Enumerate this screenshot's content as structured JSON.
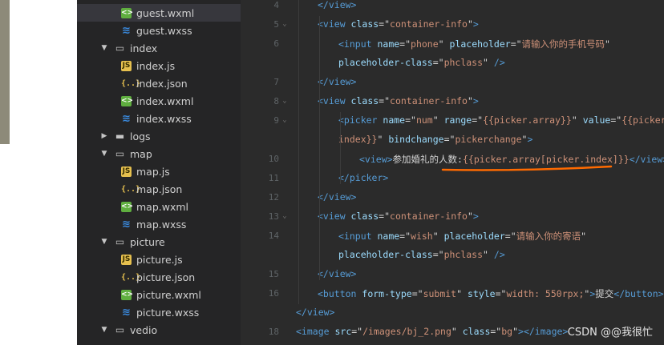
{
  "explorer": {
    "items": [
      {
        "label": "guest.wxml",
        "icon": "wxml-file-icon",
        "type": "file",
        "selected": true
      },
      {
        "label": "guest.wxss",
        "icon": "wxss-file-icon",
        "type": "file"
      },
      {
        "label": "index",
        "icon": "folder-open-icon",
        "type": "folder",
        "expanded": true
      },
      {
        "label": "index.js",
        "icon": "js-file-icon",
        "type": "file"
      },
      {
        "label": "index.json",
        "icon": "json-file-icon",
        "type": "file"
      },
      {
        "label": "index.wxml",
        "icon": "wxml-file-icon",
        "type": "file"
      },
      {
        "label": "index.wxss",
        "icon": "wxss-file-icon",
        "type": "file"
      },
      {
        "label": "logs",
        "icon": "folder-closed-icon",
        "type": "folder",
        "expanded": false
      },
      {
        "label": "map",
        "icon": "folder-open-icon",
        "type": "folder",
        "expanded": true
      },
      {
        "label": "map.js",
        "icon": "js-file-icon",
        "type": "file"
      },
      {
        "label": "map.json",
        "icon": "json-file-icon",
        "type": "file"
      },
      {
        "label": "map.wxml",
        "icon": "wxml-file-icon",
        "type": "file"
      },
      {
        "label": "map.wxss",
        "icon": "wxss-file-icon",
        "type": "file"
      },
      {
        "label": "picture",
        "icon": "folder-open-icon",
        "type": "folder",
        "expanded": true
      },
      {
        "label": "picture.js",
        "icon": "js-file-icon",
        "type": "file"
      },
      {
        "label": "picture.json",
        "icon": "json-file-icon",
        "type": "file"
      },
      {
        "label": "picture.wxml",
        "icon": "wxml-file-icon",
        "type": "file"
      },
      {
        "label": "picture.wxss",
        "icon": "wxss-file-icon",
        "type": "file"
      },
      {
        "label": "vedio",
        "icon": "folder-open-icon",
        "type": "folder",
        "expanded": true
      }
    ]
  },
  "editor": {
    "line_numbers": [
      "4",
      "5",
      "6",
      "",
      "7",
      "8",
      "9",
      "",
      "10",
      "11",
      "12",
      "13",
      "14",
      "",
      "15",
      "16",
      "",
      "18"
    ],
    "fold_markers": [
      "",
      "v",
      "",
      "",
      "",
      "v",
      "v",
      "",
      "",
      "",
      "",
      "v",
      "",
      "",
      "",
      "",
      "",
      ""
    ],
    "lines": [
      {
        "tokens": [
          [
            "t",
            "</view>"
          ]
        ]
      },
      {
        "tokens": [
          [
            "t",
            "<view "
          ],
          [
            "a",
            "class"
          ],
          [
            "p",
            "=\""
          ],
          [
            "s",
            "container-info"
          ],
          [
            "p",
            "\""
          ],
          [
            "t",
            ">"
          ]
        ]
      },
      {
        "tokens": [
          [
            "t",
            "<input "
          ],
          [
            "a",
            "name"
          ],
          [
            "p",
            "=\""
          ],
          [
            "s",
            "phone"
          ],
          [
            "p",
            "\" "
          ],
          [
            "a",
            "placeholder"
          ],
          [
            "p",
            "=\""
          ],
          [
            "s",
            "请输入你的手机号码"
          ],
          [
            "p",
            "\""
          ]
        ]
      },
      {
        "tokens": [
          [
            "a",
            "placeholder-class"
          ],
          [
            "p",
            "=\""
          ],
          [
            "s",
            "phclass"
          ],
          [
            "p",
            "\" "
          ],
          [
            "t",
            "/>"
          ]
        ]
      },
      {
        "tokens": [
          [
            "t",
            "</view>"
          ]
        ]
      },
      {
        "tokens": [
          [
            "t",
            "<view "
          ],
          [
            "a",
            "class"
          ],
          [
            "p",
            "=\""
          ],
          [
            "s",
            "container-info"
          ],
          [
            "p",
            "\""
          ],
          [
            "t",
            ">"
          ]
        ]
      },
      {
        "tokens": [
          [
            "t",
            "<picker "
          ],
          [
            "a",
            "name"
          ],
          [
            "p",
            "=\""
          ],
          [
            "s",
            "num"
          ],
          [
            "p",
            "\" "
          ],
          [
            "a",
            "range"
          ],
          [
            "p",
            "=\""
          ],
          [
            "s",
            "{{picker.array}}"
          ],
          [
            "p",
            "\" "
          ],
          [
            "a",
            "value"
          ],
          [
            "p",
            "=\""
          ],
          [
            "s",
            "{{picker."
          ]
        ]
      },
      {
        "tokens": [
          [
            "s",
            "index}}"
          ],
          [
            "p",
            "\" "
          ],
          [
            "a",
            "bindchange"
          ],
          [
            "p",
            "=\""
          ],
          [
            "s",
            "pickerchange"
          ],
          [
            "p",
            "\""
          ],
          [
            "t",
            ">"
          ]
        ]
      },
      {
        "tokens": [
          [
            "t",
            "<view>"
          ],
          [
            "p",
            "参加婚礼的人数:"
          ],
          [
            "s",
            "{{picker.array[picker.index]}}"
          ],
          [
            "t",
            "</view>"
          ]
        ]
      },
      {
        "tokens": [
          [
            "t",
            "</picker>"
          ]
        ]
      },
      {
        "tokens": [
          [
            "t",
            "</view>"
          ]
        ]
      },
      {
        "tokens": [
          [
            "t",
            "<view "
          ],
          [
            "a",
            "class"
          ],
          [
            "p",
            "=\""
          ],
          [
            "s",
            "container-info"
          ],
          [
            "p",
            "\""
          ],
          [
            "t",
            ">"
          ]
        ]
      },
      {
        "tokens": [
          [
            "t",
            "<input "
          ],
          [
            "a",
            "name"
          ],
          [
            "p",
            "=\""
          ],
          [
            "s",
            "wish"
          ],
          [
            "p",
            "\" "
          ],
          [
            "a",
            "placeholder"
          ],
          [
            "p",
            "=\""
          ],
          [
            "s",
            "请输入你的寄语"
          ],
          [
            "p",
            "\""
          ]
        ]
      },
      {
        "tokens": [
          [
            "a",
            "placeholder-class"
          ],
          [
            "p",
            "=\""
          ],
          [
            "s",
            "phclass"
          ],
          [
            "p",
            "\" "
          ],
          [
            "t",
            "/>"
          ]
        ]
      },
      {
        "tokens": [
          [
            "t",
            "</view>"
          ]
        ]
      },
      {
        "tokens": [
          [
            "t",
            "<button "
          ],
          [
            "a",
            "form-type"
          ],
          [
            "p",
            "=\""
          ],
          [
            "s",
            "submit"
          ],
          [
            "p",
            "\" "
          ],
          [
            "a",
            "style"
          ],
          [
            "p",
            "=\""
          ],
          [
            "s",
            "width: 550rpx;"
          ],
          [
            "p",
            "\""
          ],
          [
            "t",
            ">"
          ],
          [
            "p",
            "提交"
          ],
          [
            "t",
            "</button>"
          ]
        ]
      },
      {
        "tokens": [
          [
            "t",
            "</view>"
          ]
        ]
      },
      {
        "tokens": [
          [
            "t",
            "<image "
          ],
          [
            "a",
            "src"
          ],
          [
            "p",
            "=\""
          ],
          [
            "s",
            "/images/bj_2.png"
          ],
          [
            "p",
            "\" "
          ],
          [
            "a",
            "class"
          ],
          [
            "p",
            "=\""
          ],
          [
            "s",
            "bg"
          ],
          [
            "p",
            "\""
          ],
          [
            "t",
            "></image>"
          ]
        ]
      }
    ]
  },
  "colors": {
    "tag": "#569cd6",
    "attribute": "#9cdcfe",
    "string": "#ce9178",
    "plain": "#d4d4d4",
    "annotation_underline": "#ff6a00"
  },
  "watermark": {
    "text": "CSDN @@我很忙"
  }
}
